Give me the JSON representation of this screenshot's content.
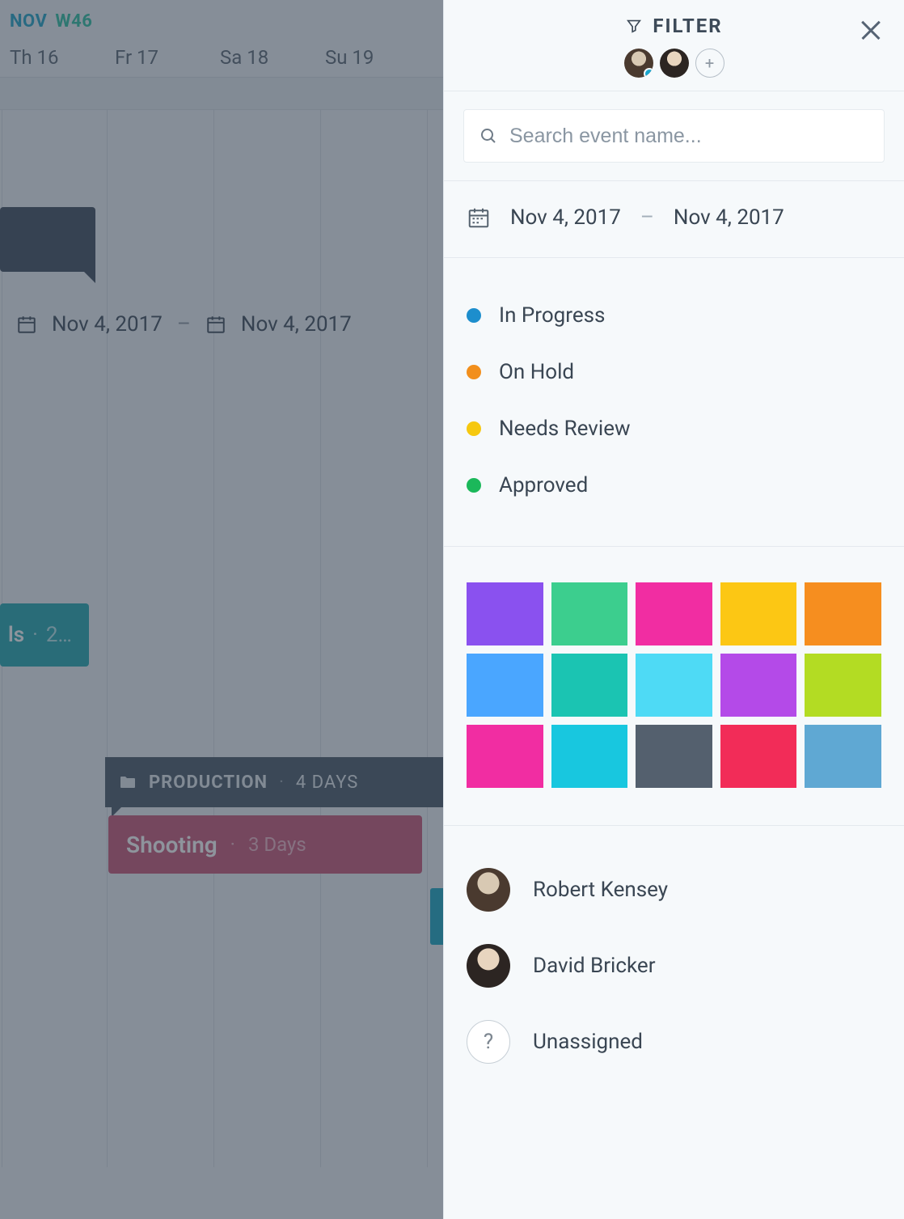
{
  "calendar": {
    "month": "NOV",
    "week": "W46",
    "days": [
      "Th 16",
      "Fr 17",
      "Sa 18",
      "Su 19"
    ],
    "date_from": "Nov 4, 2017",
    "date_sep": "–",
    "date_to": "Nov 4, 2017",
    "teal_tag_suffix": "ls",
    "teal_tag_dot": "·",
    "teal_tag_count": "2…",
    "prod_label": "PRODUCTION",
    "prod_sep": "·",
    "prod_meta": "4 DAYS",
    "shoot_label": "Shooting",
    "shoot_sep": "·",
    "shoot_meta": "3 Days"
  },
  "panel": {
    "title": "FILTER",
    "search_placeholder": "Search event name...",
    "date_from": "Nov 4, 2017",
    "date_sep": "–",
    "date_to": "Nov 4, 2017",
    "statuses": [
      {
        "label": "In Progress",
        "color": "#1d8ecd"
      },
      {
        "label": "On Hold",
        "color": "#f28f1c"
      },
      {
        "label": "Needs Review",
        "color": "#f6c80f"
      },
      {
        "label": "Approved",
        "color": "#1bb85a"
      }
    ],
    "colors": [
      "#8a51ef",
      "#3cce8e",
      "#f12da2",
      "#fcc714",
      "#f68e1f",
      "#4aa6ff",
      "#1bc4b2",
      "#4edaf5",
      "#b44ae8",
      "#b3dc23",
      "#f12da2",
      "#18c7df",
      "#54606e",
      "#f22c58",
      "#5fa8d3"
    ],
    "people": [
      {
        "name": "Robert Kensey"
      },
      {
        "name": "David Bricker"
      },
      {
        "name": "Unassigned"
      }
    ],
    "unassigned_glyph": "?"
  }
}
